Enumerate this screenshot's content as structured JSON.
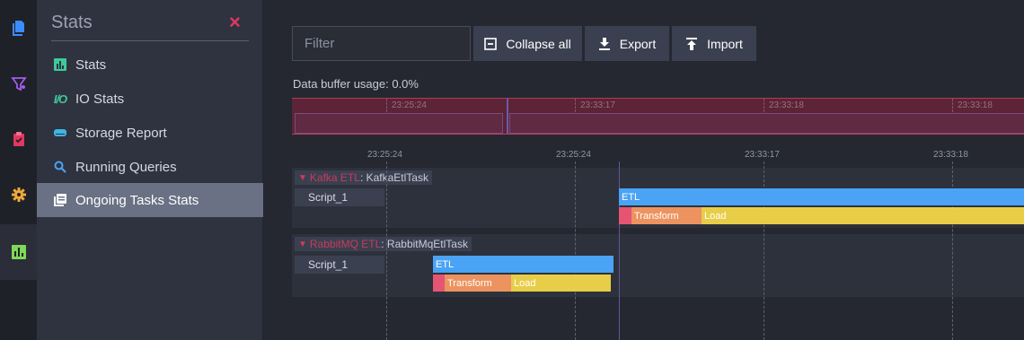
{
  "colors": {
    "accent_red": "#e0385e",
    "etl": "#4aa3f5",
    "transform": "#ec9360",
    "load": "#e8cd48",
    "group_name": "#c83a5c"
  },
  "rail": {
    "items": [
      {
        "icon": "documents-icon",
        "color": "#3b8cff"
      },
      {
        "icon": "indexes-icon",
        "color": "#a35cf0"
      },
      {
        "icon": "tasks-clipboard-icon",
        "color": "#e0385e"
      },
      {
        "icon": "settings-gear-icon",
        "color": "#f0a93a"
      },
      {
        "icon": "stats-chart-icon",
        "color": "#7ed957",
        "active": true
      }
    ]
  },
  "menu": {
    "title": "Stats",
    "close": "×",
    "items": [
      {
        "label": "Stats",
        "icon": "bar-chart-icon"
      },
      {
        "label": "IO Stats",
        "icon": "io-stats-icon",
        "glyph": "I/O"
      },
      {
        "label": "Storage Report",
        "icon": "storage-icon"
      },
      {
        "label": "Running Queries",
        "icon": "search-icon"
      },
      {
        "label": "Ongoing Tasks Stats",
        "icon": "ongoing-tasks-icon",
        "active": true
      }
    ]
  },
  "toolbar": {
    "filter_placeholder": "Filter",
    "collapse_label": "Collapse all",
    "export_label": "Export",
    "import_label": "Import"
  },
  "buffer_usage": "Data buffer usage: 0.0%",
  "overview": {
    "ticks": [
      "23:25:24",
      "23:33:17",
      "23:33:18",
      "23:33:18"
    ]
  },
  "axis": {
    "ticks": [
      "23:25:24",
      "23:25:24",
      "23:33:17",
      "23:33:18"
    ]
  },
  "groups": [
    {
      "name": "Kafka ETL",
      "type": ": KafkaEtlTask",
      "script": "Script_1",
      "etl_label": "ETL",
      "transform_label": "Transform",
      "load_label": "Load"
    },
    {
      "name": "RabbitMQ ETL",
      "type": ": RabbitMqEtlTask",
      "script": "Script_1",
      "etl_label": "ETL",
      "transform_label": "Transform",
      "load_label": "Load"
    }
  ]
}
